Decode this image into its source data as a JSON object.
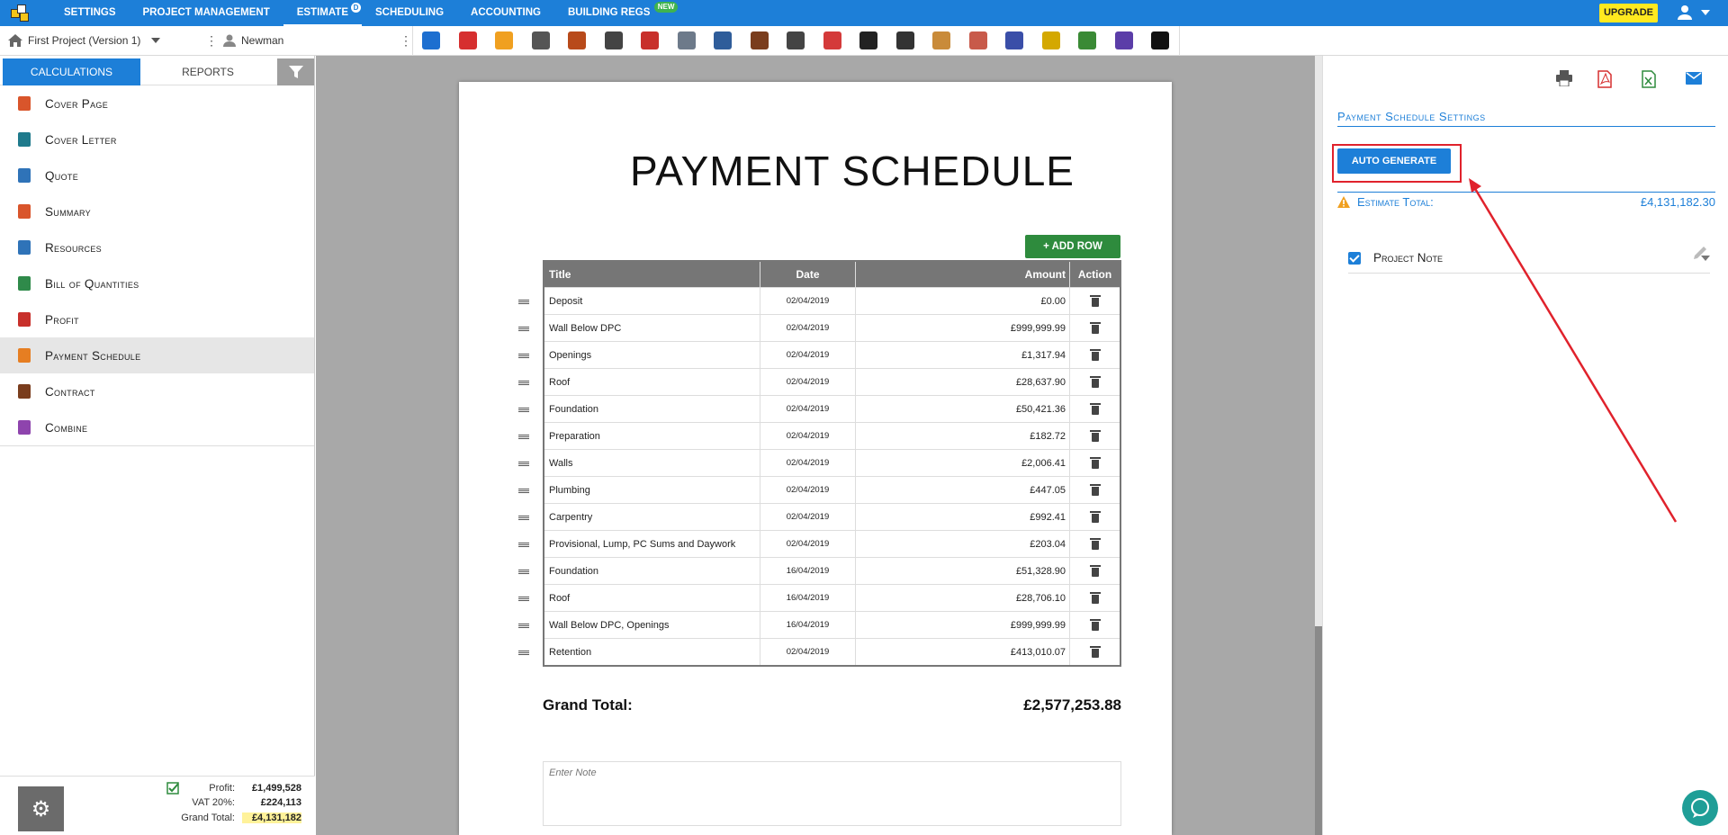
{
  "nav": {
    "items": [
      {
        "label": "SETTINGS"
      },
      {
        "label": "PROJECT MANAGEMENT"
      },
      {
        "label": "ESTIMATE",
        "badge": "D"
      },
      {
        "label": "SCHEDULING"
      },
      {
        "label": "ACCOUNTING"
      },
      {
        "label": "BUILDING REGS",
        "badge": "NEW"
      }
    ],
    "upgrade_label": "UPGRADE"
  },
  "toolbar": {
    "project": "First Project (Version 1)",
    "client": "Newman",
    "tool_colors": [
      "#1d6fd0",
      "#d62f2f",
      "#f0a020",
      "#555",
      "#b84a1a",
      "#444",
      "#c8302b",
      "#6d7a8a",
      "#2f5d9a",
      "#7a3d1d",
      "#444",
      "#d43a3a",
      "#222",
      "#333",
      "#c98b3a",
      "#c85a4a",
      "#3a4ea8",
      "#d4a800",
      "#3a8a35",
      "#5b3da8",
      "#111"
    ]
  },
  "sidebar": {
    "tabs": {
      "calculations": "CALCULATIONS",
      "reports": "REPORTS"
    },
    "items": [
      {
        "label": "Cover Page",
        "icon": "document-icon",
        "color": "#d9552b"
      },
      {
        "label": "Cover Letter",
        "icon": "letter-icon",
        "color": "#1f7a8c"
      },
      {
        "label": "Quote",
        "icon": "quote-icon",
        "color": "#2f73b8"
      },
      {
        "label": "Summary",
        "icon": "sigma-icon",
        "color": "#d9552b"
      },
      {
        "label": "Resources",
        "icon": "resources-icon",
        "color": "#2f73b8"
      },
      {
        "label": "Bill of Quantities",
        "icon": "pyramid-icon",
        "color": "#2f8a4a"
      },
      {
        "label": "Profit",
        "icon": "hand-icon",
        "color": "#c8302b"
      },
      {
        "label": "Payment Schedule",
        "icon": "calendar-icon",
        "color": "#e67e22"
      },
      {
        "label": "Contract",
        "icon": "handshake-icon",
        "color": "#7a3d1d"
      },
      {
        "label": "Combine",
        "icon": "share-icon",
        "color": "#8e44ad"
      }
    ],
    "footer": {
      "profit_label": "Profit:",
      "profit": "£1,499,528",
      "vat_label": "VAT 20%:",
      "vat": "£224,113",
      "total_label": "Grand Total:",
      "total": "£4,131,182"
    }
  },
  "document": {
    "title": "PAYMENT SCHEDULE",
    "add_row": "ADD ROW",
    "columns": [
      "Title",
      "Date",
      "Amount",
      "Action"
    ],
    "rows": [
      {
        "title": "Deposit",
        "date": "02/04/2019",
        "amount": "£0.00"
      },
      {
        "title": "Wall Below DPC",
        "date": "02/04/2019",
        "amount": "£999,999.99"
      },
      {
        "title": "Openings",
        "date": "02/04/2019",
        "amount": "£1,317.94"
      },
      {
        "title": "Roof",
        "date": "02/04/2019",
        "amount": "£28,637.90"
      },
      {
        "title": "Foundation",
        "date": "02/04/2019",
        "amount": "£50,421.36"
      },
      {
        "title": "Preparation",
        "date": "02/04/2019",
        "amount": "£182.72"
      },
      {
        "title": "Walls",
        "date": "02/04/2019",
        "amount": "£2,006.41"
      },
      {
        "title": "Plumbing",
        "date": "02/04/2019",
        "amount": "£447.05"
      },
      {
        "title": "Carpentry",
        "date": "02/04/2019",
        "amount": "£992.41"
      },
      {
        "title": "Provisional, Lump, PC Sums and Daywork",
        "date": "02/04/2019",
        "amount": "£203.04"
      },
      {
        "title": "Foundation",
        "date": "16/04/2019",
        "amount": "£51,328.90"
      },
      {
        "title": "Roof",
        "date": "16/04/2019",
        "amount": "£28,706.10"
      },
      {
        "title": "Wall Below DPC, Openings",
        "date": "16/04/2019",
        "amount": "£999,999.99"
      },
      {
        "title": "Retention",
        "date": "02/04/2019",
        "amount": "£413,010.07"
      }
    ],
    "grand_total_label": "Grand Total:",
    "grand_total": "£2,577,253.88",
    "note_placeholder": "Enter Note"
  },
  "settings": {
    "title": "Payment Schedule Settings",
    "auto_generate": "AUTO GENERATE",
    "estimate_total_label": "Estimate Total:",
    "estimate_total": "£4,131,182.30",
    "project_note_label": "Project Note",
    "project_note_checked": true
  }
}
